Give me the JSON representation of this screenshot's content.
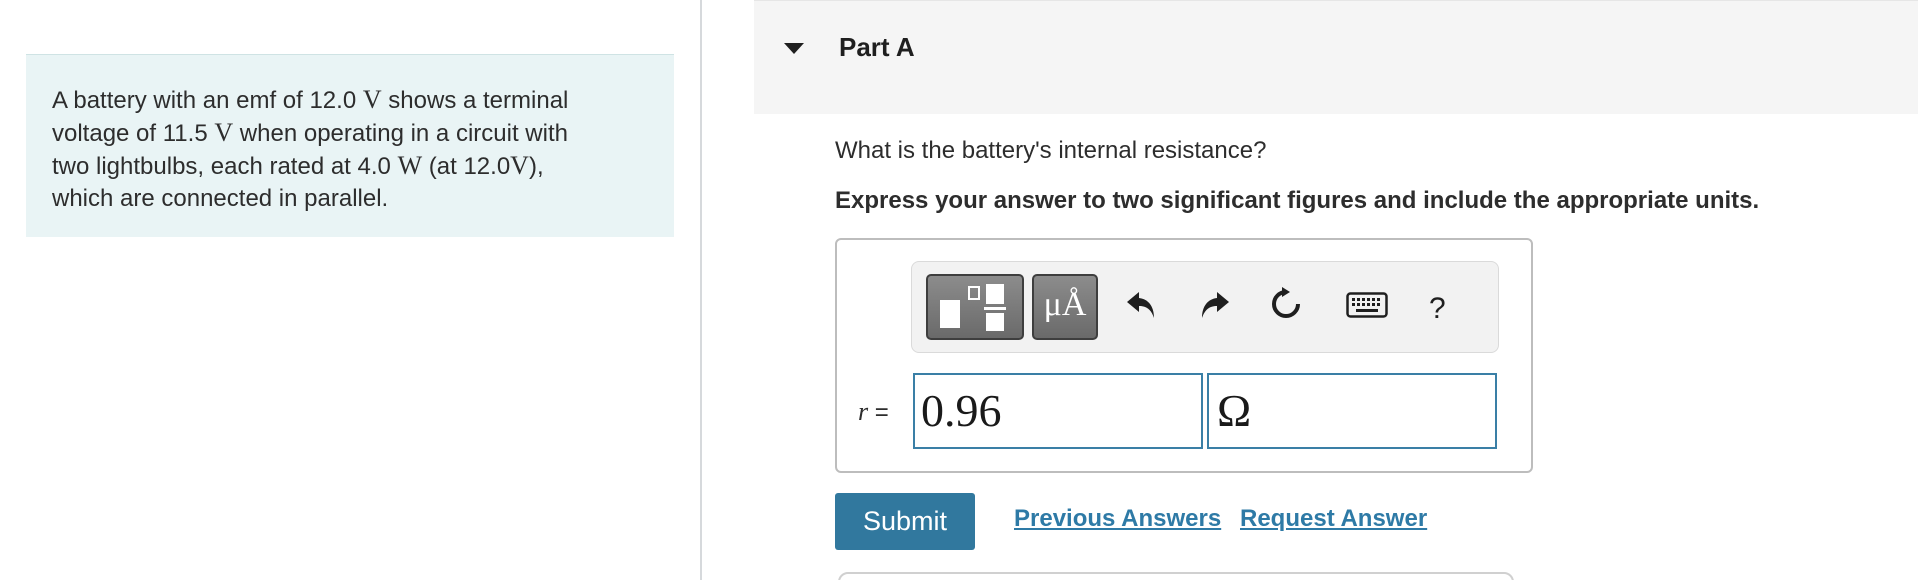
{
  "problem": {
    "line1_pre": "A battery with an emf of 12.0",
    "line1_unit": "V",
    "line1_post": "shows a terminal",
    "line2_pre": "voltage of 11.5",
    "line2_unit": "V",
    "line2_post": "when operating in a circuit with",
    "line3_pre": "two lightbulbs, each rated at 4.0",
    "line3_unit": "W",
    "line3_mid": "(at 12.0",
    "line3_unit2": "V",
    "line3_post": "),",
    "line4": "which are connected in parallel."
  },
  "part": {
    "title": "Part A",
    "question": "What is the battery's internal resistance?",
    "instruction": "Express your answer to two significant figures and include the appropriate units."
  },
  "toolbar": {
    "units_label": "μÅ",
    "help_label": "?"
  },
  "answer": {
    "variable": "r",
    "equals": "=",
    "value": "0.96",
    "units": "Ω"
  },
  "actions": {
    "submit": "Submit",
    "previous_answers": "Previous Answers",
    "request_answer": "Request Answer"
  }
}
